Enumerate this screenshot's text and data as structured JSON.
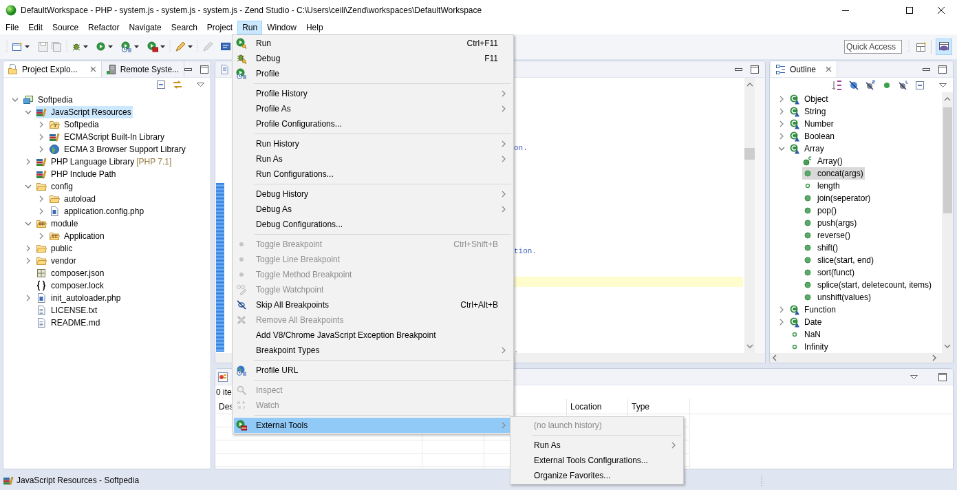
{
  "window": {
    "title": "DefaultWorkspace - PHP - system.js - system.js - system.js - Zend Studio - C:\\Users\\ceili\\Zend\\workspaces\\DefaultWorkspace"
  },
  "menubar": [
    {
      "label": "File",
      "selected": false
    },
    {
      "label": "Edit",
      "selected": false
    },
    {
      "label": "Source",
      "selected": false
    },
    {
      "label": "Refactor",
      "selected": false
    },
    {
      "label": "Navigate",
      "selected": false
    },
    {
      "label": "Search",
      "selected": false
    },
    {
      "label": "Project",
      "selected": false
    },
    {
      "label": "Run",
      "selected": true
    },
    {
      "label": "Window",
      "selected": false
    },
    {
      "label": "Help",
      "selected": false
    }
  ],
  "toolbar": {
    "quick_access": {
      "placeholder": "Quick Access"
    }
  },
  "project_explorer": {
    "tabs": [
      {
        "label": "Project Explo...",
        "selected": true
      },
      {
        "label": "Remote Syste...",
        "selected": false
      }
    ],
    "tree": [
      {
        "label": "Softpedia",
        "kind": "project",
        "expanded": true,
        "selected": false,
        "children": [
          {
            "label": "JavaScript Resources",
            "kind": "library",
            "expanded": true,
            "selected": true,
            "children": [
              {
                "label": "Softpedia",
                "kind": "jsfolder",
                "expanded": false,
                "selected": false
              },
              {
                "label": "ECMAScript Built-In Library",
                "kind": "library",
                "expanded": false,
                "selected": false
              },
              {
                "label": "ECMA 3 Browser Support Library",
                "kind": "globe",
                "expanded": false,
                "selected": false
              }
            ]
          },
          {
            "label": "PHP Language Library",
            "note": "[PHP 7.1]",
            "kind": "library",
            "expanded": false,
            "selected": false
          },
          {
            "label": "PHP Include Path",
            "kind": "library",
            "selected": false
          },
          {
            "label": "config",
            "kind": "folder",
            "expanded": true,
            "selected": false,
            "children": [
              {
                "label": "autoload",
                "kind": "folder",
                "expanded": false,
                "selected": false
              },
              {
                "label": "application.config.php",
                "kind": "php",
                "expanded": false,
                "selected": false
              }
            ]
          },
          {
            "label": "module",
            "kind": "package",
            "expanded": true,
            "selected": false,
            "children": [
              {
                "label": "Application",
                "kind": "package",
                "expanded": false,
                "selected": false
              }
            ]
          },
          {
            "label": "public",
            "kind": "folder",
            "expanded": false,
            "selected": false
          },
          {
            "label": "vendor",
            "kind": "folder",
            "expanded": false,
            "selected": false
          },
          {
            "label": "composer.json",
            "kind": "json",
            "selected": false
          },
          {
            "label": "composer.lock",
            "kind": "braces",
            "selected": false
          },
          {
            "label": "init_autoloader.php",
            "kind": "php",
            "expanded": false,
            "selected": false
          },
          {
            "label": "LICENSE.txt",
            "kind": "text",
            "selected": false
          },
          {
            "label": "README.md",
            "kind": "text",
            "selected": false
          }
        ]
      }
    ]
  },
  "editor": {
    "fragments": [
      "on.",
      "tion.",
      "."
    ]
  },
  "outline": {
    "title": "Outline",
    "tree": [
      {
        "label": "Object",
        "kind": "class",
        "expanded": false,
        "selected": false
      },
      {
        "label": "String",
        "kind": "class",
        "expanded": false,
        "selected": false
      },
      {
        "label": "Number",
        "kind": "class",
        "expanded": false,
        "selected": false
      },
      {
        "label": "Boolean",
        "kind": "class",
        "expanded": false,
        "selected": false
      },
      {
        "label": "Array",
        "kind": "class",
        "expanded": true,
        "selected": false,
        "children": [
          {
            "label": "Array()",
            "kind": "constructor",
            "selected": false
          },
          {
            "label": "concat(args)",
            "kind": "method",
            "selected": true
          },
          {
            "label": "length",
            "kind": "field",
            "selected": false
          },
          {
            "label": "join(seperator)",
            "kind": "method",
            "selected": false
          },
          {
            "label": "pop()",
            "kind": "method",
            "selected": false
          },
          {
            "label": "push(args)",
            "kind": "method",
            "selected": false
          },
          {
            "label": "reverse()",
            "kind": "method",
            "selected": false
          },
          {
            "label": "shift()",
            "kind": "method",
            "selected": false
          },
          {
            "label": "slice(start, end)",
            "kind": "method",
            "selected": false
          },
          {
            "label": "sort(funct)",
            "kind": "method",
            "selected": false
          },
          {
            "label": "splice(start, deletecount, items)",
            "kind": "method",
            "selected": false
          },
          {
            "label": "unshift(values)",
            "kind": "method",
            "selected": false
          }
        ]
      },
      {
        "label": "Function",
        "kind": "class",
        "expanded": false,
        "selected": false
      },
      {
        "label": "Date",
        "kind": "class",
        "expanded": false,
        "selected": false
      },
      {
        "label": "NaN",
        "kind": "field",
        "selected": false
      },
      {
        "label": "Infinity",
        "kind": "field",
        "selected": false
      }
    ]
  },
  "problems": {
    "count": "0 ite",
    "columns": [
      "Des",
      "Location",
      "Type"
    ]
  },
  "status_bar": {
    "text": "JavaScript Resources - Softpedia"
  },
  "run_menu": {
    "items": [
      {
        "kind": "run",
        "label": "Run",
        "shortcut": "Ctrl+F11",
        "submenu": false,
        "disabled": false,
        "selected": false
      },
      {
        "kind": "debug",
        "label": "Debug",
        "shortcut": "F11",
        "submenu": false,
        "disabled": false,
        "selected": false
      },
      {
        "kind": "profile",
        "label": "Profile",
        "submenu": false,
        "disabled": false,
        "selected": false
      },
      {
        "kind": "separator"
      },
      {
        "kind": "item",
        "label": "Profile History",
        "submenu": true,
        "disabled": false,
        "selected": false
      },
      {
        "kind": "item",
        "label": "Profile As",
        "submenu": true,
        "disabled": false,
        "selected": false
      },
      {
        "kind": "item",
        "label": "Profile Configurations...",
        "submenu": false,
        "disabled": false,
        "selected": false
      },
      {
        "kind": "separator"
      },
      {
        "kind": "item",
        "label": "Run History",
        "submenu": true,
        "disabled": false,
        "selected": false
      },
      {
        "kind": "item",
        "label": "Run As",
        "submenu": true,
        "disabled": false,
        "selected": false
      },
      {
        "kind": "item",
        "label": "Run Configurations...",
        "submenu": false,
        "disabled": false,
        "selected": false
      },
      {
        "kind": "separator"
      },
      {
        "kind": "item",
        "label": "Debug History",
        "submenu": true,
        "disabled": false,
        "selected": false
      },
      {
        "kind": "item",
        "label": "Debug As",
        "submenu": true,
        "disabled": false,
        "selected": false
      },
      {
        "kind": "item",
        "label": "Debug Configurations...",
        "submenu": false,
        "disabled": false,
        "selected": false
      },
      {
        "kind": "separator"
      },
      {
        "kind": "dot",
        "label": "Toggle Breakpoint",
        "shortcut": "Ctrl+Shift+B",
        "submenu": false,
        "disabled": true,
        "selected": false
      },
      {
        "kind": "dot",
        "label": "Toggle Line Breakpoint",
        "submenu": false,
        "disabled": true,
        "selected": false
      },
      {
        "kind": "dot",
        "label": "Toggle Method Breakpoint",
        "submenu": false,
        "disabled": true,
        "selected": false
      },
      {
        "kind": "watchpoint",
        "label": "Toggle Watchpoint",
        "submenu": false,
        "disabled": true,
        "selected": false
      },
      {
        "kind": "skip",
        "label": "Skip All Breakpoints",
        "shortcut": "Ctrl+Alt+B",
        "submenu": false,
        "disabled": false,
        "selected": false
      },
      {
        "kind": "remove",
        "label": "Remove All Breakpoints",
        "submenu": false,
        "disabled": true,
        "selected": false
      },
      {
        "kind": "item",
        "label": "Add V8/Chrome JavaScript Exception Breakpoint",
        "submenu": false,
        "disabled": false,
        "selected": false
      },
      {
        "kind": "item",
        "label": "Breakpoint Types",
        "submenu": true,
        "disabled": false,
        "selected": false
      },
      {
        "kind": "separator"
      },
      {
        "kind": "url",
        "label": "Profile URL",
        "submenu": false,
        "disabled": false,
        "selected": false
      },
      {
        "kind": "separator"
      },
      {
        "kind": "inspect",
        "label": "Inspect",
        "submenu": false,
        "disabled": true,
        "selected": false
      },
      {
        "kind": "watch",
        "label": "Watch",
        "submenu": false,
        "disabled": true,
        "selected": false
      },
      {
        "kind": "separator"
      },
      {
        "kind": "tools",
        "label": "External Tools",
        "submenu": true,
        "disabled": false,
        "selected": true
      }
    ]
  },
  "external_tools_menu": {
    "items": [
      {
        "kind": "item",
        "label": "(no launch history)",
        "submenu": false,
        "disabled": true,
        "selected": false
      },
      {
        "kind": "separator"
      },
      {
        "kind": "item",
        "label": "Run As",
        "submenu": true,
        "disabled": false,
        "selected": false
      },
      {
        "kind": "item",
        "label": "External Tools Configurations...",
        "submenu": false,
        "disabled": false,
        "selected": false
      },
      {
        "kind": "item",
        "label": "Organize Favorites...",
        "submenu": false,
        "disabled": false,
        "selected": false
      }
    ]
  }
}
